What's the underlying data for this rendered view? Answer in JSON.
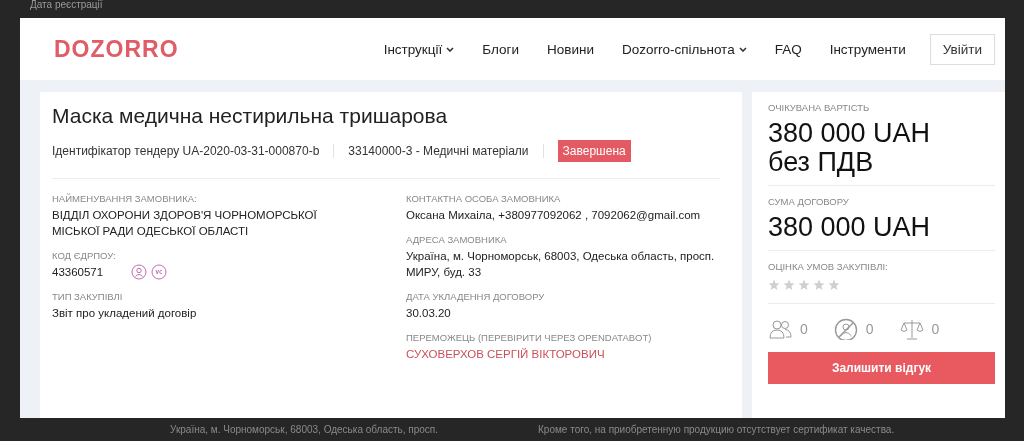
{
  "background_page": {
    "top_texts": [
      "Дата реєстрації"
    ],
    "bottom_texts": [
      "Україна, м. Чорноморськ, 68003, Одеська область, просп.",
      "Кроме того, на приобретенную продукцию отсутствует сертификат качества."
    ]
  },
  "header": {
    "logo": "DOZORRO",
    "nav": [
      {
        "label": "Інструкції",
        "dropdown": true
      },
      {
        "label": "Блоги",
        "dropdown": false
      },
      {
        "label": "Новини",
        "dropdown": false
      },
      {
        "label": "Dozorro-спільнота",
        "dropdown": true
      },
      {
        "label": "FAQ",
        "dropdown": false
      },
      {
        "label": "Інструменти",
        "dropdown": false
      }
    ],
    "login_button": "Увійти"
  },
  "tender": {
    "title": "Маска медична нестирильна тришарова",
    "id": "Ідентифікатор тендеру UA-2020-03-31-000870-b",
    "cpv": "33140000-3 - Медичні матеріали",
    "status": "Завершена"
  },
  "details_left": [
    {
      "kind": "text",
      "label": "НАЙМЕНУВАННЯ ЗАМОВНИКА:",
      "value": "ВІДДІЛ ОХОРОНИ ЗДОРОВ'Я ЧОРНОМОРСЬКОЇ МІСЬКОЇ РАДИ ОДЕСЬКОЇ ОБЛАСТІ"
    },
    {
      "kind": "code",
      "label": "КОД ЄДРПОУ:",
      "value": "43360571"
    },
    {
      "kind": "text",
      "label": "ТИП ЗАКУПІВЛІ",
      "value": "Звіт про укладений договір"
    }
  ],
  "details_right": [
    {
      "kind": "text",
      "label": "КОНТАКТНА ОСОБА ЗАМОВНИКА",
      "value": "Оксана Михаіла, +380977092062 , 7092062@gmail.com"
    },
    {
      "kind": "text",
      "label": "АДРЕСА ЗАМОВНИКА",
      "value": "Україна, м. Чорноморськ, 68003, Одеська область, просп. МИРУ, буд. 33"
    },
    {
      "kind": "text",
      "label": "ДАТА УКЛАДЕННЯ ДОГОВОРУ",
      "value": "30.03.20"
    },
    {
      "kind": "link",
      "label": "ПЕРЕМОЖЕЦЬ (ПЕРЕВІРИТИ ЧЕРЕЗ OPENDATABOT)",
      "value": "СУХОВЕРХОВ СЕРГІЙ ВІКТОРОВИЧ"
    }
  ],
  "sidebar": {
    "expected_label": "ОЧІКУВАНА ВАРТІСТЬ",
    "expected_value": "380 000 UAH без ПДВ",
    "contract_label": "СУМА ДОГОВОРУ",
    "contract_value": "380 000 UAH",
    "rating_label": "ОЦІНКА УМОВ ЗАКУПІВЛІ:",
    "stars": 0,
    "stats": [
      {
        "kind": "people",
        "count": "0"
      },
      {
        "kind": "no-person",
        "count": "0"
      },
      {
        "kind": "scales",
        "count": "0"
      }
    ],
    "feedback_button": "Залишити відгук"
  }
}
